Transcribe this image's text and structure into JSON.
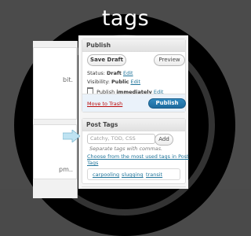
{
  "slide": {
    "title": "tags"
  },
  "left_column": {
    "row1_text": "bit.",
    "row2_text": "pm.."
  },
  "publish_box": {
    "title": "Publish",
    "save_draft": "Save Draft",
    "preview": "Preview",
    "status_label": "Status:",
    "status_value": "Draft",
    "status_edit": "Edit",
    "visibility_label": "Visibility:",
    "visibility_value": "Public",
    "visibility_edit": "Edit",
    "publish_label": "Publish",
    "publish_value": "immediately",
    "publish_edit": "Edit",
    "move_to_trash": "Move to Trash",
    "publish_button": "Publish"
  },
  "post_tags": {
    "title": "Post Tags",
    "input_placeholder": "Catchy, TOD, CSS",
    "add_button": "Add",
    "hint": "Separate tags with commas.",
    "choose_link_line1": "Choose from the most used tags in Post",
    "choose_link_line2": "Tags",
    "tags": [
      "carpooling",
      "slugging",
      "transit"
    ]
  },
  "colors": {
    "link": "#21759b",
    "trash": "#bc0b0b",
    "publish_button": "#21759b",
    "arrow": "#bfe3f2"
  },
  "icons": {
    "calendar": "calendar-icon",
    "arrow": "arrow-right-icon"
  }
}
